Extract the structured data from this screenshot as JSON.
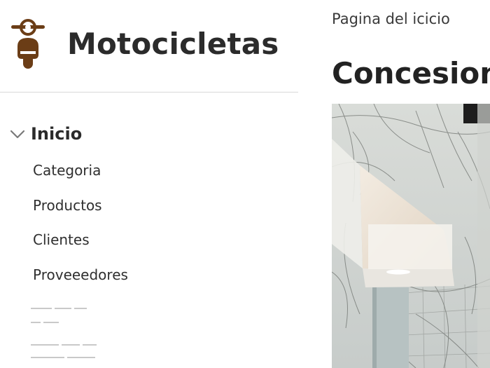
{
  "brand": {
    "title": "Motocicletas",
    "logo_icon": "scooter-icon",
    "logo_color": "#6b3d16"
  },
  "nav": {
    "group_label": "Inicio",
    "group_icon": "chevron-down-icon",
    "items": [
      {
        "label": "Categoria"
      },
      {
        "label": "Productos"
      },
      {
        "label": "Clientes"
      },
      {
        "label": "Proveeedores"
      }
    ]
  },
  "main": {
    "breadcrumb": "Pagina del icicio",
    "title": "Concesion"
  }
}
